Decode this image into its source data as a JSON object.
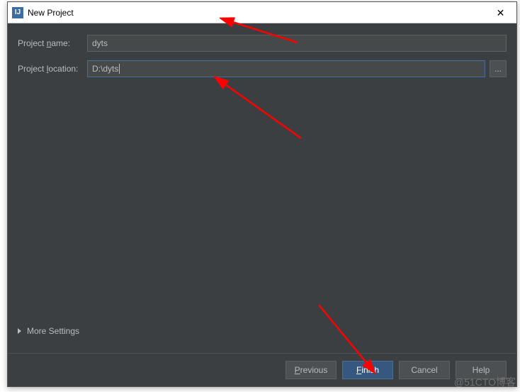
{
  "window": {
    "title": "New Project"
  },
  "form": {
    "project_name_label_pre": "Project ",
    "project_name_label_m": "n",
    "project_name_label_post": "ame:",
    "project_name_value": "dyts",
    "project_location_label_pre": "Project ",
    "project_location_label_m": "l",
    "project_location_label_post": "ocation:",
    "project_location_value": "D:\\dyts",
    "browse_label": "..."
  },
  "more_settings_label": "More Settings",
  "buttons": {
    "previous_m": "P",
    "previous_post": "revious",
    "finish_m": "F",
    "finish_post": "inish",
    "cancel": "Cancel",
    "help": "Help"
  },
  "watermark": "@51CTO博客"
}
